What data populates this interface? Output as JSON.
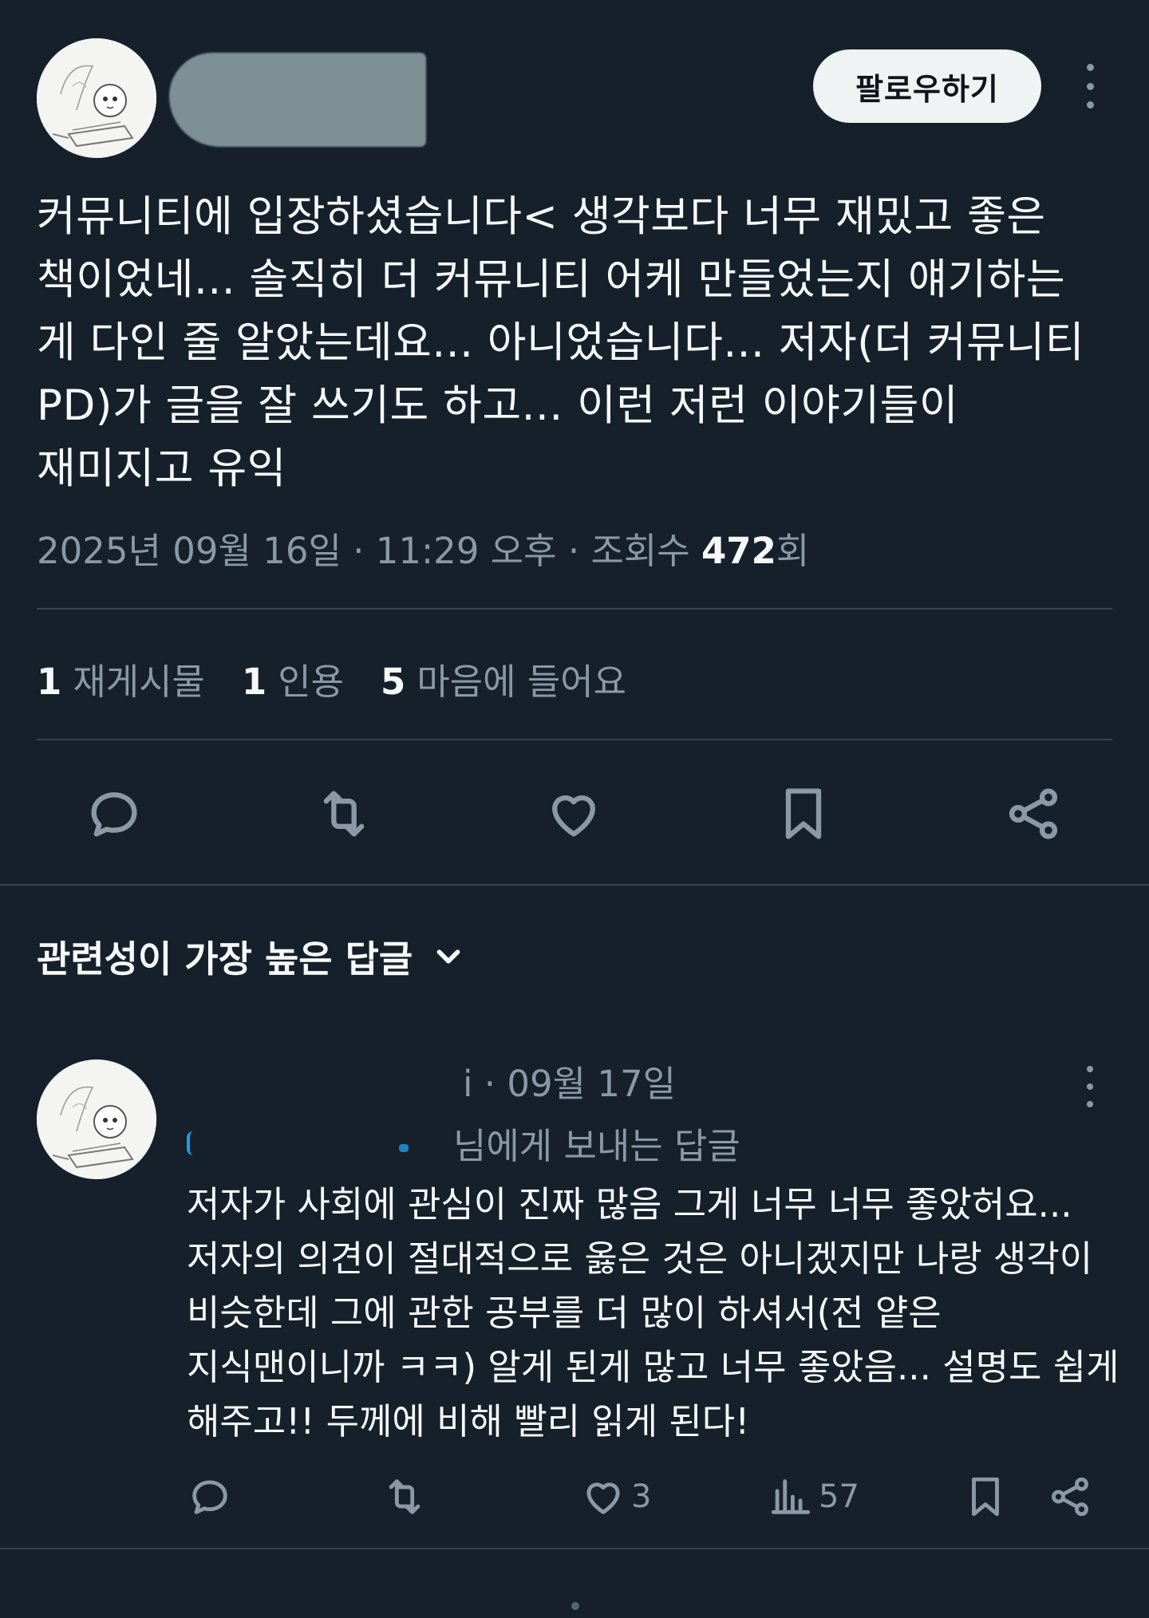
{
  "tweet": {
    "follow_label": "팔로우하기",
    "text": "커뮤니티에 입장하셨습니다< 생각보다 너무 재밌고 좋은\n책이었네... 솔직히 더 커뮤니티 어케 만들었는지 얘기하는\n게 다인 줄 알았는데요... 아니었습니다... 저자(더 커뮤니티\nPD)가 글을 잘 쓰기도 하고... 이런 저런 이야기들이\n재미지고 유익",
    "meta_prefix": "2025년 09월 16일 · 11:29 오후 · 조회수 ",
    "views": "472",
    "views_suffix": "회",
    "stats": [
      {
        "count": "1",
        "label": "재게시물"
      },
      {
        "count": "1",
        "label": "인용"
      },
      {
        "count": "5",
        "label": "마음에 들어요"
      }
    ]
  },
  "replies_section": {
    "title": "관련성이 가장 높은 답글"
  },
  "reply": {
    "head": "i · 09월 17일",
    "reply_to": "님에게 보내는 답글",
    "text": "저자가 사회에 관심이 진짜 많음 그게 너무 너무 좋았허요...\n저자의 의견이 절대적으로 옳은 것은 아니겠지만 나랑 생각이\n비슷한데 그에 관한 공부를 더 많이 하셔서(전 얕은\n지식맨이니까 ㅋㅋ) 알게 된게 많고 너무 좋았음... 설명도 쉽게\n해주고!! 두께에 비해 빨리 읽게 된다!",
    "likes": "3",
    "views": "57"
  },
  "icons": {
    "reply": "reply-icon",
    "retweet": "retweet-icon",
    "like": "heart-icon",
    "bookmark": "bookmark-icon",
    "share": "share-icon",
    "views": "views-icon",
    "more": "more-icon",
    "chevron": "chevron-down-icon"
  },
  "colors": {
    "background": "#15202b",
    "text": "#f7f9f9",
    "muted": "#8b98a5",
    "divider": "#38444d",
    "accent": "#1d9bf0"
  }
}
